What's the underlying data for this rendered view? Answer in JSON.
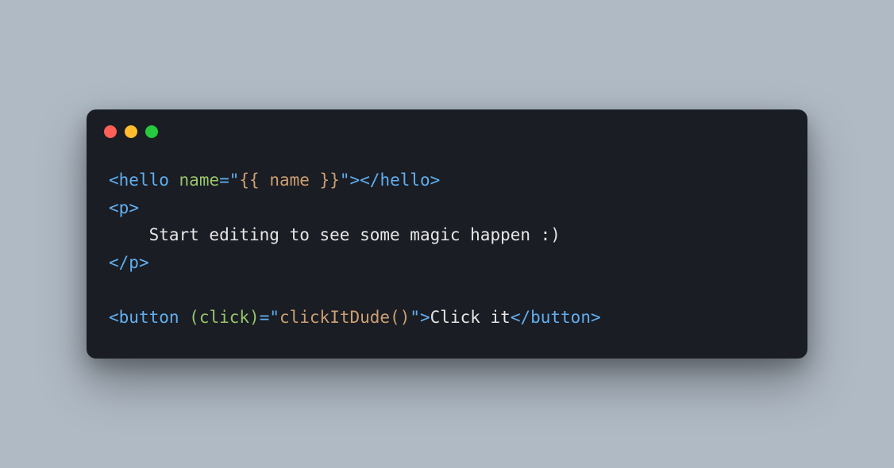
{
  "code": {
    "line1": {
      "open_bracket": "<",
      "tag1": "hello",
      "space": " ",
      "attr": "name",
      "eq_q": "=\"",
      "val": "{{ name }}",
      "q_close": "\">",
      "close_open": "</",
      "tag1b": "hello",
      "close_bracket": ">"
    },
    "line2": {
      "open": "<",
      "tag": "p",
      "close": ">"
    },
    "line3": {
      "indent": "    ",
      "text": "Start editing to see some magic happen :)"
    },
    "line4": {
      "open": "</",
      "tag": "p",
      "close": ">"
    },
    "blank": "",
    "line5": {
      "open": "<",
      "tag": "button",
      "space": " ",
      "attr": "(click)",
      "eq_q": "=\"",
      "val": "clickItDude()",
      "q_close": "\">",
      "text": "Click it",
      "close_open": "</",
      "tagb": "button",
      "close_bracket": ">"
    }
  }
}
